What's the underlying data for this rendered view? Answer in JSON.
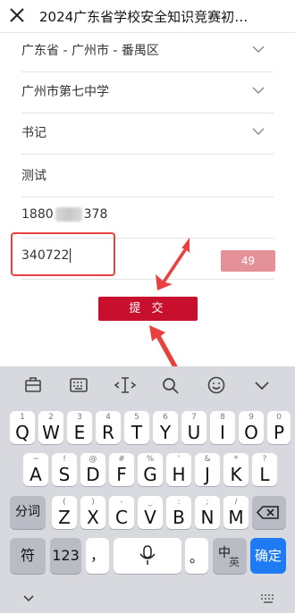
{
  "window": {
    "title": "2024广东省学校安全知识竞赛初赛..."
  },
  "form": {
    "region": "广东省 - 广州市 - 番禺区",
    "school": "广州市第七中学",
    "role": "书记",
    "name": "测试",
    "phone_prefix": "1880",
    "phone_suffix": "378",
    "code_value": "340722",
    "countdown": "49",
    "submit_label": "提 交"
  },
  "keyboard": {
    "row1": [
      {
        "k": "Q",
        "s": "1"
      },
      {
        "k": "W",
        "s": "2"
      },
      {
        "k": "E",
        "s": "3"
      },
      {
        "k": "R",
        "s": "4"
      },
      {
        "k": "T",
        "s": "5"
      },
      {
        "k": "Y",
        "s": "6"
      },
      {
        "k": "U",
        "s": "7"
      },
      {
        "k": "I",
        "s": "8"
      },
      {
        "k": "O",
        "s": "9"
      },
      {
        "k": "P",
        "s": "0"
      }
    ],
    "row2": [
      {
        "k": "A",
        "s": "~"
      },
      {
        "k": "S",
        "s": "!"
      },
      {
        "k": "D",
        "s": "@"
      },
      {
        "k": "F",
        "s": "#"
      },
      {
        "k": "G",
        "s": "%"
      },
      {
        "k": "H",
        "s": "'"
      },
      {
        "k": "J",
        "s": "&"
      },
      {
        "k": "K",
        "s": "*"
      },
      {
        "k": "L",
        "s": "?"
      }
    ],
    "row3": [
      {
        "k": "Z",
        "s": "("
      },
      {
        "k": "X",
        "s": ")"
      },
      {
        "k": "C",
        "s": "-"
      },
      {
        "k": "V",
        "s": "_"
      },
      {
        "k": "B",
        "s": ":"
      },
      {
        "k": "N",
        "s": ";"
      },
      {
        "k": "M",
        "s": "/"
      }
    ],
    "fenci": "分词",
    "fu": "符",
    "num": "123",
    "comma": "，",
    "period": "。",
    "zh": "中",
    "en": "英",
    "enter": "确定"
  },
  "colors": {
    "accent": "#c8102e",
    "countdown_bg": "#e4919a",
    "annotation": "#e8413f",
    "enter": "#1e7bf3"
  }
}
